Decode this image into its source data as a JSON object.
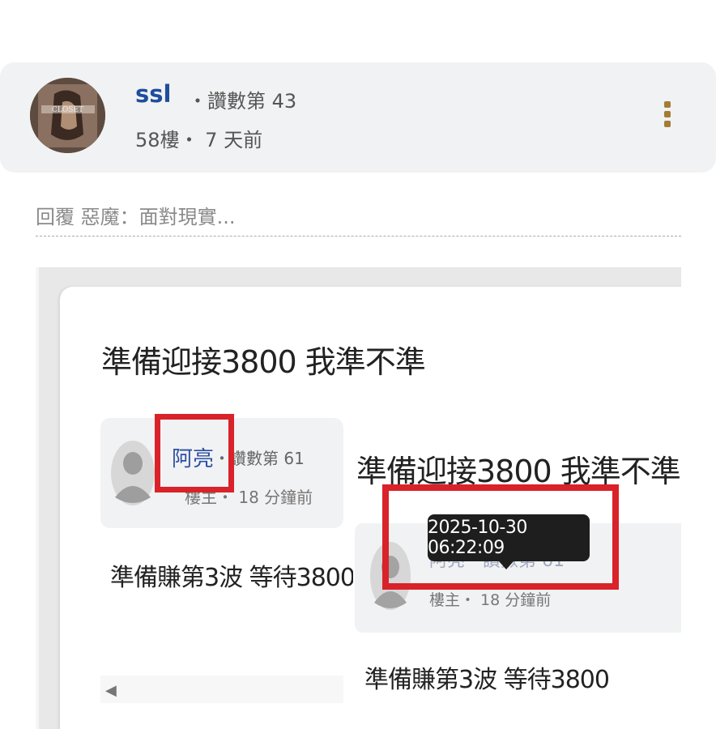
{
  "post": {
    "username": "ssl",
    "like_rank": "・讚數第 43",
    "meta": "58樓・ 7 天前",
    "avatar_text": "CLOSET"
  },
  "reply_to": "回覆 惡魔：面對現實...",
  "embedded": {
    "topic_title": "準備迎接3800 我準不準",
    "card": {
      "name": "阿亮",
      "rank": "・讚數第 61",
      "meta": "樓主・ 18 分鐘前"
    },
    "body": "準備賺第3波 等待3800",
    "overlay": {
      "title": "準備迎接3800 我準不準",
      "name": "阿亮・讚數第 61",
      "meta": "樓主・ 18 分鐘前",
      "tooltip": "2025-10-30 06:22:09",
      "body": "準備賺第3波 等待3800"
    }
  },
  "colors": {
    "username": "#1f4e9e",
    "highlight_box": "#d9222a",
    "card_bg": "#f1f2f3",
    "more_dots": "#a57b35"
  },
  "icons": {
    "more": "vertical-ellipsis-icon",
    "scroll_up": "triangle-up-icon",
    "scroll_down": "triangle-down-icon",
    "scroll_left": "triangle-left-icon"
  }
}
